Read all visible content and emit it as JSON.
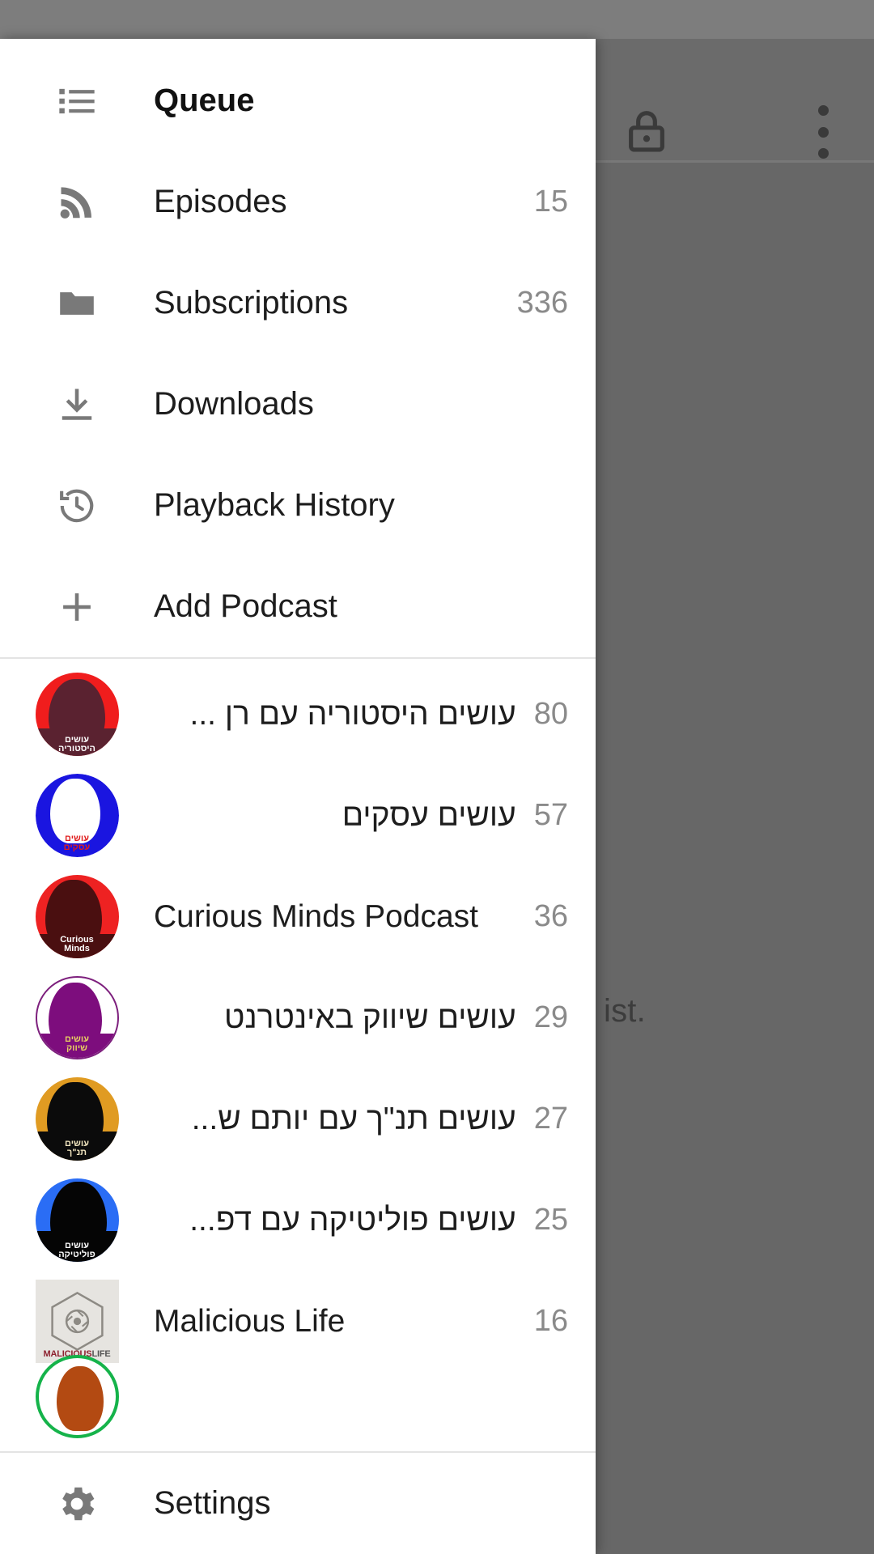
{
  "app": {
    "background": {
      "lock_icon": "lock-icon",
      "overflow_icon": "more-vert-icon",
      "partial_text": "ist."
    },
    "accent_color": "#18697f"
  },
  "drawer": {
    "nav_items": [
      {
        "icon": "list-icon",
        "label": "Queue",
        "count": "",
        "selected": true
      },
      {
        "icon": "rss-icon",
        "label": "Episodes",
        "count": "15",
        "selected": false
      },
      {
        "icon": "folder-icon",
        "label": "Subscriptions",
        "count": "336",
        "selected": false
      },
      {
        "icon": "download-icon",
        "label": "Downloads",
        "count": "",
        "selected": false
      },
      {
        "icon": "history-icon",
        "label": "Playback History",
        "count": "",
        "selected": false
      },
      {
        "icon": "plus-icon",
        "label": "Add Podcast",
        "count": "",
        "selected": false
      }
    ],
    "feeds": [
      {
        "title": "עושים היסטוריה עם רן ...",
        "count": "80",
        "art": "osim-history",
        "rtl": true
      },
      {
        "title": "עושים עסקים",
        "count": "57",
        "art": "osim-asakim",
        "rtl": true
      },
      {
        "title": "Curious Minds Podcast",
        "count": "36",
        "art": "curious-minds",
        "rtl": false
      },
      {
        "title": "עושים שיווק באינטרנט",
        "count": "29",
        "art": "osim-shivuk",
        "rtl": true
      },
      {
        "title": "עושים תנ\"ך עם יותם ש...",
        "count": "27",
        "art": "osim-tanach",
        "rtl": true
      },
      {
        "title": "עושים פוליטיקה עם דפ...",
        "count": "25",
        "art": "osim-politika",
        "rtl": true
      },
      {
        "title": "Malicious Life",
        "count": "16",
        "art": "malicious-life",
        "rtl": false
      }
    ],
    "footer": {
      "settings_icon": "gear-icon",
      "settings_label": "Settings"
    }
  }
}
